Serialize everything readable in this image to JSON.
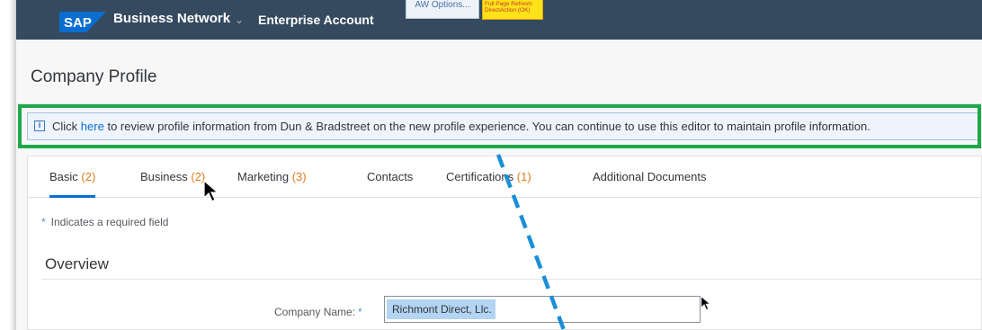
{
  "shell": {
    "brand": "SAP",
    "product": "Business Network",
    "caret": "⌄",
    "account": "Enterprise Account",
    "aw_options": "AW Options...",
    "refresh_line1": "Full Page Refresh:",
    "refresh_line2": "DirectAction (OK)",
    "brand_color": "#0a6ed1",
    "bar_color": "#354a5f"
  },
  "page": {
    "title": "Company Profile"
  },
  "message": {
    "icon": "info-icon",
    "icon_glyph": "i",
    "prefix": "Click",
    "link": "here",
    "suffix": "to review profile information from Dun & Bradstreet on the new profile experience. You can continue to use this editor to maintain profile information.",
    "highlight_color": "#1fa84a"
  },
  "tabs": [
    {
      "label": "Basic",
      "count": "(2)",
      "active": true
    },
    {
      "label": "Business",
      "count": "(2)",
      "active": false
    },
    {
      "label": "Marketing",
      "count": "(3)",
      "active": false
    },
    {
      "label": "Contacts",
      "count": "",
      "active": false
    },
    {
      "label": "Certifications",
      "count": "(1)",
      "active": false
    },
    {
      "label": "Additional Documents",
      "count": "",
      "active": false
    }
  ],
  "form": {
    "required_star": "*",
    "required_note": "Indicates a required field",
    "section_title": "Overview",
    "company_name_label": "Company Name:",
    "company_name_value": "Richmont Direct, Llc."
  },
  "colors": {
    "accent": "#0a6ed1",
    "count": "#e07c19",
    "annotation_dash": "#1a8fd8"
  }
}
